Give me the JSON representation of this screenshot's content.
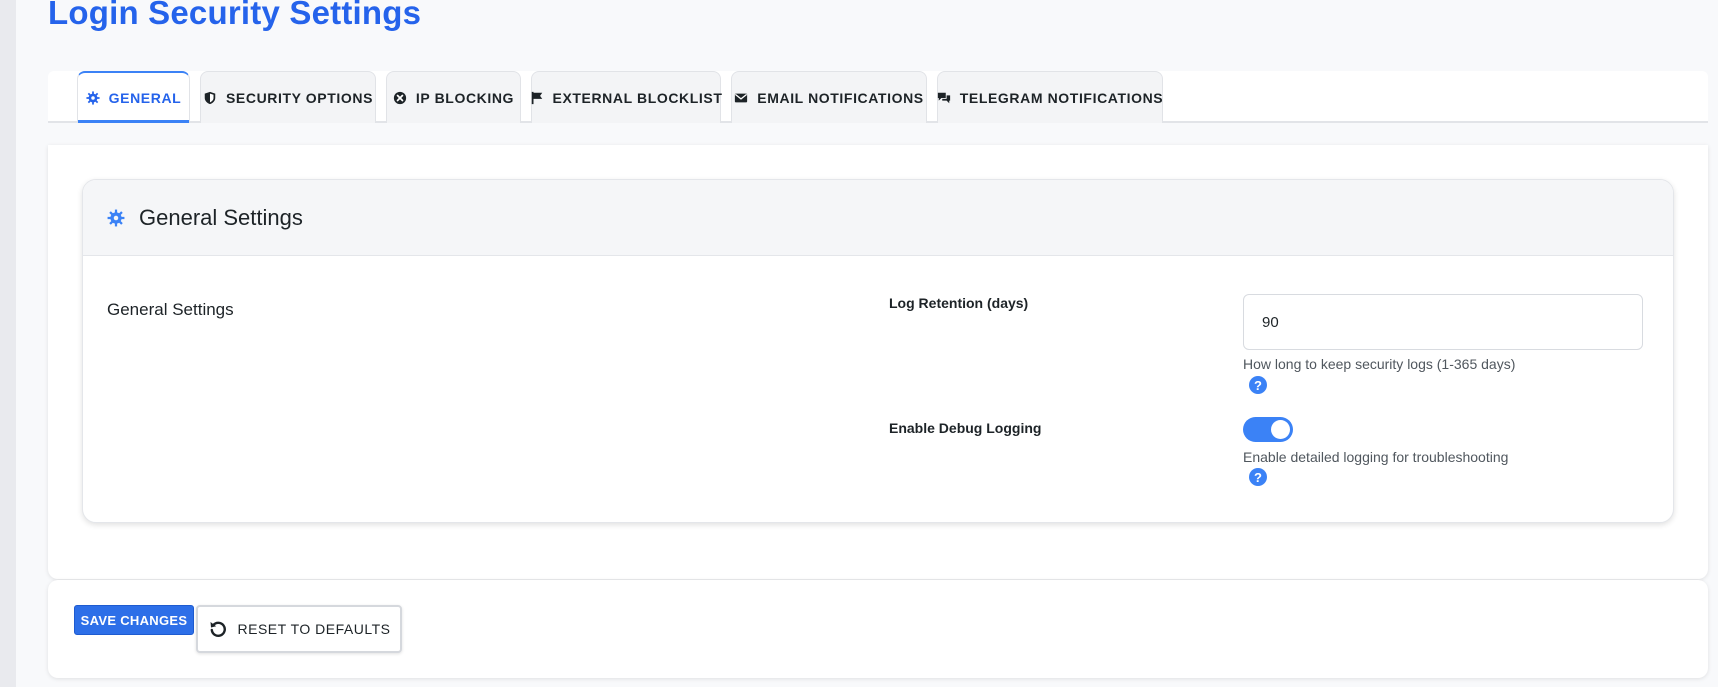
{
  "page": {
    "title": "Login Security Settings"
  },
  "tabs": [
    {
      "label": "GENERAL",
      "icon": "gear-icon",
      "active": true
    },
    {
      "label": "SECURITY OPTIONS",
      "icon": "shield-icon",
      "active": false
    },
    {
      "label": "IP BLOCKING",
      "icon": "block-icon",
      "active": false
    },
    {
      "label": "EXTERNAL BLOCKLIST",
      "icon": "flag-icon",
      "active": false
    },
    {
      "label": "EMAIL NOTIFICATIONS",
      "icon": "envelope-icon",
      "active": false
    },
    {
      "label": "TELEGRAM NOTIFICATIONS",
      "icon": "chat-icon",
      "active": false
    }
  ],
  "panel": {
    "title": "General Settings",
    "section_label": "General Settings",
    "fields": {
      "log_retention": {
        "label": "Log Retention (days)",
        "value": "90",
        "help": "How long to keep security logs (1-365 days)"
      },
      "debug_logging": {
        "label": "Enable Debug Logging",
        "enabled": true,
        "help": "Enable detailed logging for troubleshooting"
      }
    },
    "help_glyph": "?"
  },
  "actions": {
    "save_label": "SAVE CHANGES",
    "reset_label": "RESET TO DEFAULTS"
  },
  "colors": {
    "accent": "#2563eb",
    "toggle_on": "#3b82f6",
    "text": "#1d2327",
    "muted": "#50575e"
  }
}
